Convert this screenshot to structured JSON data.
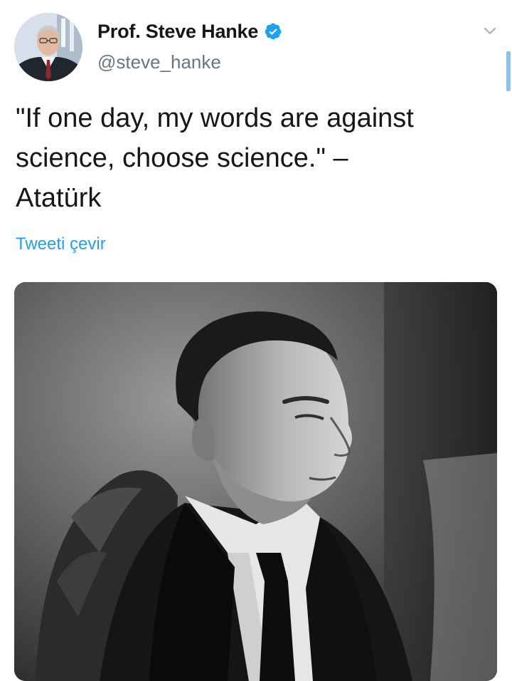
{
  "tweet": {
    "author": {
      "display_name": "Prof. Steve Hanke",
      "handle": "@steve_hanke",
      "verified": true
    },
    "text": "\"If one day, my words are against science, choose science.\" –\nAtatürk",
    "translate_label": "Tweeti çevir"
  },
  "icons": {
    "verified": "verified-badge-icon",
    "menu": "chevron-down-icon"
  },
  "colors": {
    "accent": "#1da1f2",
    "secondary_text": "#657786",
    "primary_text": "#14171a"
  }
}
